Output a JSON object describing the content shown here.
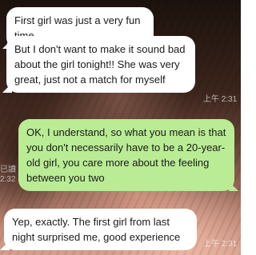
{
  "messages": [
    {
      "direction": "incoming",
      "text": "First girl was just a very fun time",
      "time": ""
    },
    {
      "direction": "incoming",
      "text": "But I don't want to make it sound bad about the girl tonight!! She was very great, just not a match for myself",
      "time": "上午 2:31"
    },
    {
      "direction": "outgoing",
      "text": "OK, I understand, so what you mean is that you don't necessarily have to be a 20-year-old girl, you care more about the feeling between you two",
      "read_status": "已讀",
      "time": "2:32"
    },
    {
      "direction": "incoming",
      "text": "Yep, exactly. The first girl from last night surprised me, good experience",
      "time": "上午 2:31"
    }
  ],
  "colors": {
    "incoming_bubble": "#ffffff",
    "outgoing_bubble": "#b9ec95"
  }
}
